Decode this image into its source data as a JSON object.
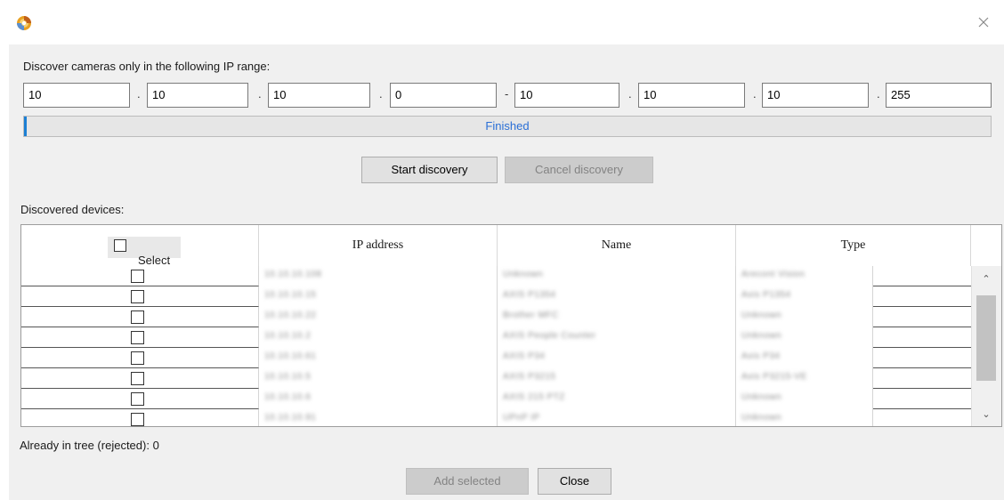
{
  "window": {
    "app_icon": "camera-discovery-logo-icon",
    "close_icon": "close-icon"
  },
  "range": {
    "label": "Discover cameras only in the following IP range:",
    "start": [
      "10",
      "10",
      "10",
      "0"
    ],
    "end": [
      "10",
      "10",
      "10",
      "255"
    ],
    "octet_separator": ".",
    "range_separator": "-"
  },
  "progress": {
    "status_text": "Finished",
    "accent_color": "#1c7fd4"
  },
  "buttons": {
    "start_discovery": "Start discovery",
    "cancel_discovery": "Cancel discovery",
    "add_selected": "Add selected",
    "close": "Close"
  },
  "devices": {
    "label": "Discovered devices:",
    "columns": {
      "select": "Select",
      "ip_address": "IP address",
      "name": "Name",
      "type": "Type"
    },
    "rows": [
      {
        "checked": false,
        "ip": "10.10.10.108",
        "name": "Unknown",
        "type": "Arecont Vision"
      },
      {
        "checked": false,
        "ip": "10.10.10.15",
        "name": "AXIS P1354",
        "type": "Axis P1354"
      },
      {
        "checked": false,
        "ip": "10.10.10.22",
        "name": "Brother MFC",
        "type": "Unknown"
      },
      {
        "checked": false,
        "ip": "10.10.10.2",
        "name": "AXIS People Counter",
        "type": "Unknown"
      },
      {
        "checked": false,
        "ip": "10.10.10.61",
        "name": "AXIS P34",
        "type": "Axis P34"
      },
      {
        "checked": false,
        "ip": "10.10.10.5",
        "name": "AXIS P3215",
        "type": "Axis P3215-VE"
      },
      {
        "checked": false,
        "ip": "10.10.10.6",
        "name": "AXIS 215 PTZ",
        "type": "Unknown"
      },
      {
        "checked": false,
        "ip": "10.10.10.91",
        "name": "UPnP IP",
        "type": "Unknown"
      }
    ]
  },
  "footer": {
    "rejected_text": "Already in tree (rejected): 0"
  }
}
